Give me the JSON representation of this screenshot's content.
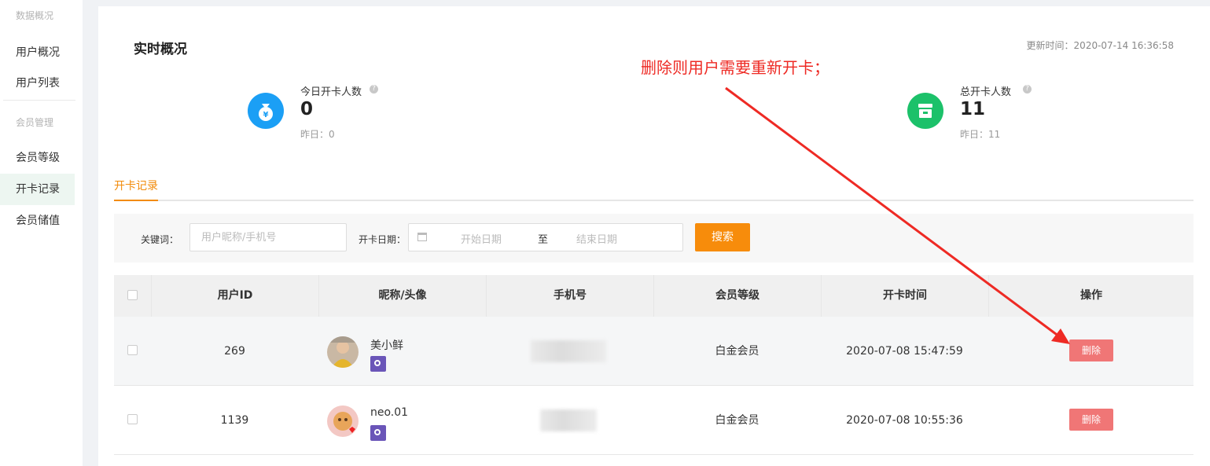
{
  "sidebar": {
    "groups": [
      {
        "title": "数据概况",
        "items": [
          "用户概况",
          "用户列表"
        ]
      },
      {
        "title": "会员管理",
        "items": [
          "会员等级",
          "开卡记录",
          "会员储值"
        ]
      }
    ],
    "active_item": "开卡记录"
  },
  "header": {
    "title": "实时概况",
    "update_time": "更新时间：2020-07-14 16:36:58"
  },
  "annotation": {
    "text": "删除则用户需要重新开卡；",
    "color": "#ee2a24"
  },
  "stats": {
    "today": {
      "label": "今日开卡人数",
      "value": "0",
      "yesterday": "昨日：0",
      "icon": "money-bag-icon",
      "color": "#1b9ff5"
    },
    "total": {
      "label": "总开卡人数",
      "value": "11",
      "yesterday": "昨日：11",
      "icon": "store-icon",
      "color": "#1cc16a"
    }
  },
  "tabs": [
    {
      "label": "开卡记录",
      "active": true
    }
  ],
  "filter": {
    "keyword_label": "关键词：",
    "keyword_placeholder": "用户昵称/手机号",
    "date_label": "开卡日期：",
    "start_placeholder": "开始日期",
    "separator": "至",
    "end_placeholder": "结束日期",
    "search_label": "搜索",
    "accent_color": "#f78c0b"
  },
  "table": {
    "columns": [
      "用户ID",
      "昵称/头像",
      "手机号",
      "会员等级",
      "开卡时间",
      "操作"
    ],
    "rows": [
      {
        "id": "269",
        "nickname": "美小鲜",
        "phone": "",
        "level": "白金会员",
        "time": "2020-07-08 15:47:59",
        "action": "删除"
      },
      {
        "id": "1139",
        "nickname": "neo.01",
        "phone": "",
        "level": "白金会员",
        "time": "2020-07-08 10:55:36",
        "action": "删除"
      }
    ]
  }
}
